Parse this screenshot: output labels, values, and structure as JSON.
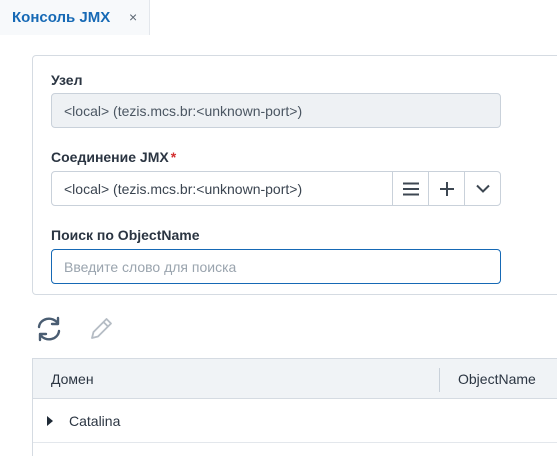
{
  "tab": {
    "label": "Консоль JMX",
    "close": "×"
  },
  "form": {
    "node_label": "Узел",
    "node_value": "<local> (tezis.mcs.br:<unknown-port>)",
    "connection_label": "Соединение JMX",
    "required_mark": "*",
    "connection_value": "<local> (tezis.mcs.br:<unknown-port>)",
    "search_label": "Поиск по ObjectName",
    "search_placeholder": "Введите слово для поиска"
  },
  "toolbar": {
    "refresh_icon": "refresh-icon",
    "edit_icon": "pencil-icon"
  },
  "grid": {
    "columns": [
      "Домен",
      "ObjectName"
    ],
    "rows": [
      {
        "label": "Catalina"
      }
    ]
  },
  "colors": {
    "accent": "#1669b5",
    "required": "#d32f2f"
  }
}
